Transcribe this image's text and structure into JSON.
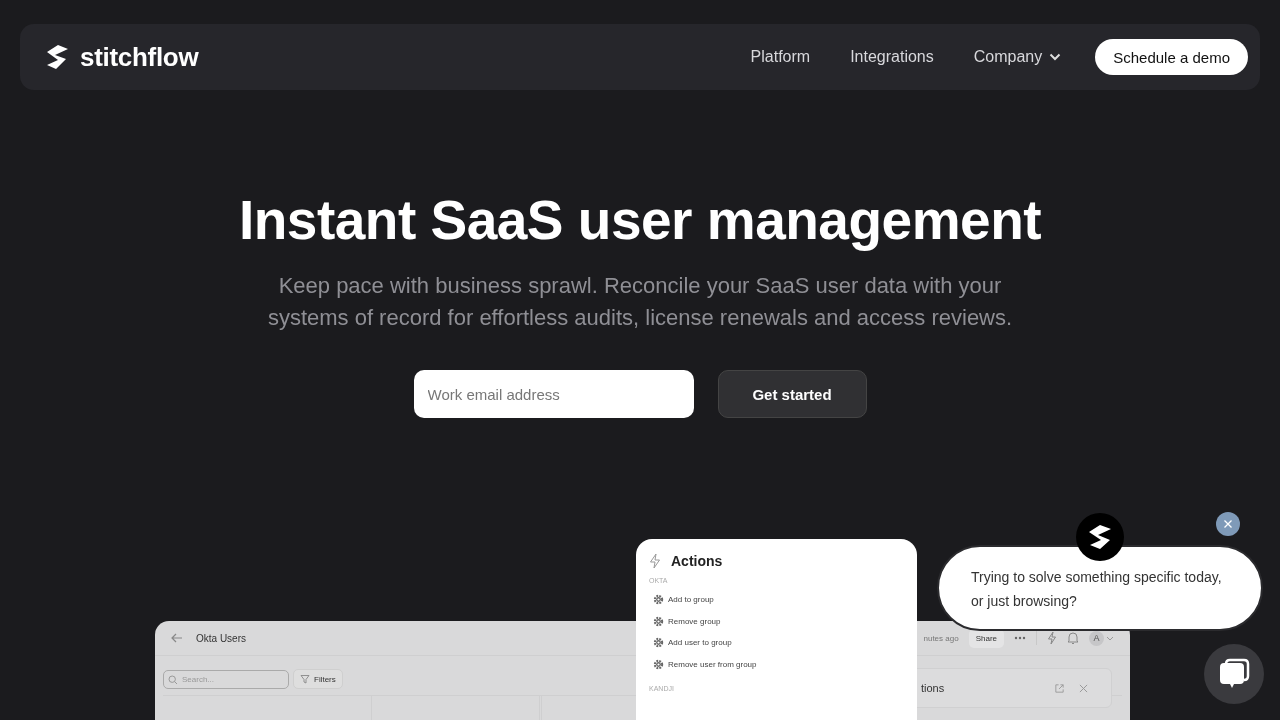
{
  "nav": {
    "logo": "stitchflow",
    "links": [
      {
        "label": "Platform",
        "dropdown": false
      },
      {
        "label": "Integrations",
        "dropdown": false
      },
      {
        "label": "Company",
        "dropdown": true
      }
    ],
    "cta": "Schedule a demo"
  },
  "hero": {
    "title": "Instant SaaS user management",
    "subtitle": "Keep pace with business sprawl. Reconcile your SaaS user data with your systems of record for effortless audits, license renewals and access reviews.",
    "email": {
      "placeholder": "Work email address"
    },
    "button": "Get started"
  },
  "app_preview": {
    "title": "Okta Users",
    "updated": "nutes ago",
    "share": "Share",
    "avatar": "A",
    "search": {
      "placeholder": "Search..."
    },
    "filters": "Filters",
    "panel_title": "tions"
  },
  "actions_popup": {
    "title": "Actions",
    "groups": [
      {
        "label": "OKTA",
        "items": [
          "Add to group",
          "Remove group",
          "Add user to group",
          "Remove user from group"
        ]
      },
      {
        "label": "KANDJI"
      }
    ]
  },
  "chat": {
    "message": "Trying to solve something specific today, or just browsing?"
  }
}
